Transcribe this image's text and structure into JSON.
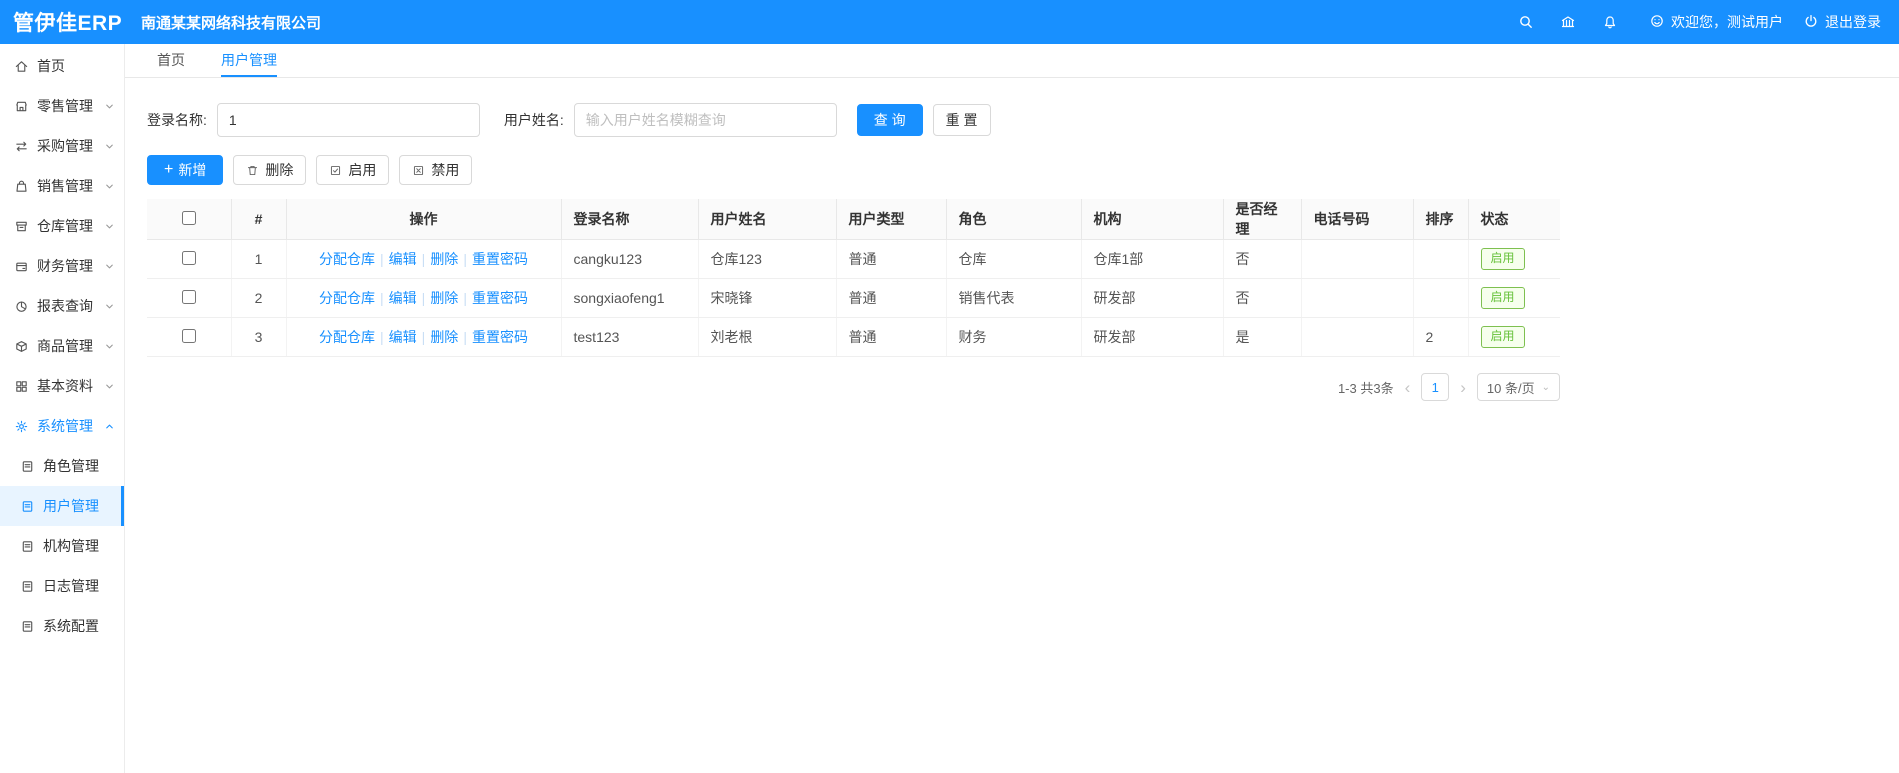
{
  "header": {
    "logo": "管伊佳ERP",
    "company": "南通某某网络科技有限公司",
    "welcome": "欢迎您，测试用户",
    "logout": "退出登录"
  },
  "tabs": [
    {
      "label": "首页"
    },
    {
      "label": "用户管理"
    }
  ],
  "sidebar": {
    "items": [
      {
        "label": "首页",
        "icon": "home-icon"
      },
      {
        "label": "零售管理",
        "icon": "retail-icon"
      },
      {
        "label": "采购管理",
        "icon": "purchase-icon"
      },
      {
        "label": "销售管理",
        "icon": "sales-icon"
      },
      {
        "label": "仓库管理",
        "icon": "warehouse-icon"
      },
      {
        "label": "财务管理",
        "icon": "finance-icon"
      },
      {
        "label": "报表查询",
        "icon": "report-icon"
      },
      {
        "label": "商品管理",
        "icon": "product-icon"
      },
      {
        "label": "基本资料",
        "icon": "basic-data-icon"
      },
      {
        "label": "系统管理",
        "icon": "gear-icon"
      }
    ],
    "subitems": [
      {
        "label": "角色管理"
      },
      {
        "label": "用户管理"
      },
      {
        "label": "机构管理"
      },
      {
        "label": "日志管理"
      },
      {
        "label": "系统配置"
      }
    ]
  },
  "filters": {
    "login_name_label": "登录名称:",
    "login_name_value": "1",
    "user_name_label": "用户姓名:",
    "user_name_placeholder": "输入用户姓名模糊查询",
    "search_button": "查 询",
    "reset_button": "重 置"
  },
  "toolbar": {
    "add": "新增",
    "delete": "删除",
    "enable": "启用",
    "disable": "禁用"
  },
  "table": {
    "columns": [
      "#",
      "操作",
      "登录名称",
      "用户姓名",
      "用户类型",
      "角色",
      "机构",
      "是否经理",
      "电话号码",
      "排序",
      "状态"
    ],
    "action_links": [
      "分配仓库",
      "编辑",
      "删除",
      "重置密码"
    ],
    "rows": [
      {
        "index": "1",
        "login": "cangku123",
        "name": "仓库123",
        "type": "普通",
        "role": "仓库",
        "org": "仓库1部",
        "manager": "否",
        "phone": "",
        "sort": "",
        "status": "启用"
      },
      {
        "index": "2",
        "login": "songxiaofeng1",
        "name": "宋晓锋",
        "type": "普通",
        "role": "销售代表",
        "org": "研发部",
        "manager": "否",
        "phone": "",
        "sort": "",
        "status": "启用"
      },
      {
        "index": "3",
        "login": "test123",
        "name": "刘老根",
        "type": "普通",
        "role": "财务",
        "org": "研发部",
        "manager": "是",
        "phone": "",
        "sort": "2",
        "status": "启用"
      }
    ]
  },
  "pagination": {
    "total": "1-3 共3条",
    "current_page": "1",
    "page_size": "10 条/页"
  },
  "colors": {
    "primary": "#1890ff",
    "enabled_green": "#67c23a",
    "header_bg": "#1890ff"
  }
}
